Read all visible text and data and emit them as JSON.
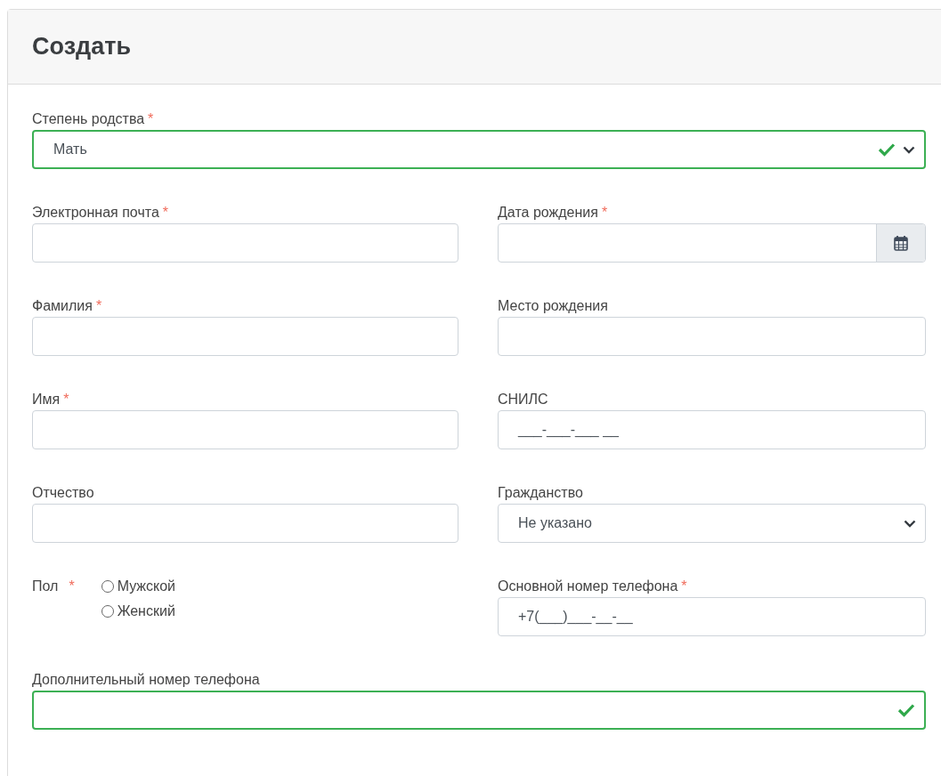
{
  "title": "Создать",
  "top_field": {
    "kind": "select",
    "label": "Степень родства",
    "required_mark": "*",
    "value": "Мать",
    "valid": true
  },
  "left_column": [
    {
      "kind": "input",
      "label": "Электронная почта",
      "required_mark": "*",
      "valid": false
    },
    {
      "kind": "input",
      "label": "Фамилия",
      "required_mark": "*",
      "valid": false
    },
    {
      "kind": "input",
      "label": "Имя",
      "required_mark": "*",
      "valid": false
    },
    {
      "kind": "input",
      "label": "Отчество",
      "valid": false
    },
    {
      "kind": "radio",
      "label": "Пол",
      "required_mark": "*",
      "options": [
        {
          "label": "Мужской",
          "selected": false
        },
        {
          "label": "Женский",
          "selected": false
        }
      ]
    }
  ],
  "right_column": [
    {
      "kind": "date",
      "label": "Дата рождения",
      "required_mark": "*",
      "valid": false
    },
    {
      "kind": "input",
      "label": "Место рождения",
      "valid": false
    },
    {
      "kind": "input",
      "label": "СНИЛС",
      "value": "___-___-___ __",
      "valid": false
    },
    {
      "kind": "select",
      "label": "Гражданство",
      "value": "Не указано",
      "valid": false
    },
    {
      "kind": "input",
      "label": "Основной номер телефона",
      "required_mark": "*",
      "value": "+7(___)___-__-__",
      "valid": false
    }
  ],
  "bottom_field": {
    "kind": "input",
    "label": "Дополнительный номер телефона",
    "valid": true
  }
}
